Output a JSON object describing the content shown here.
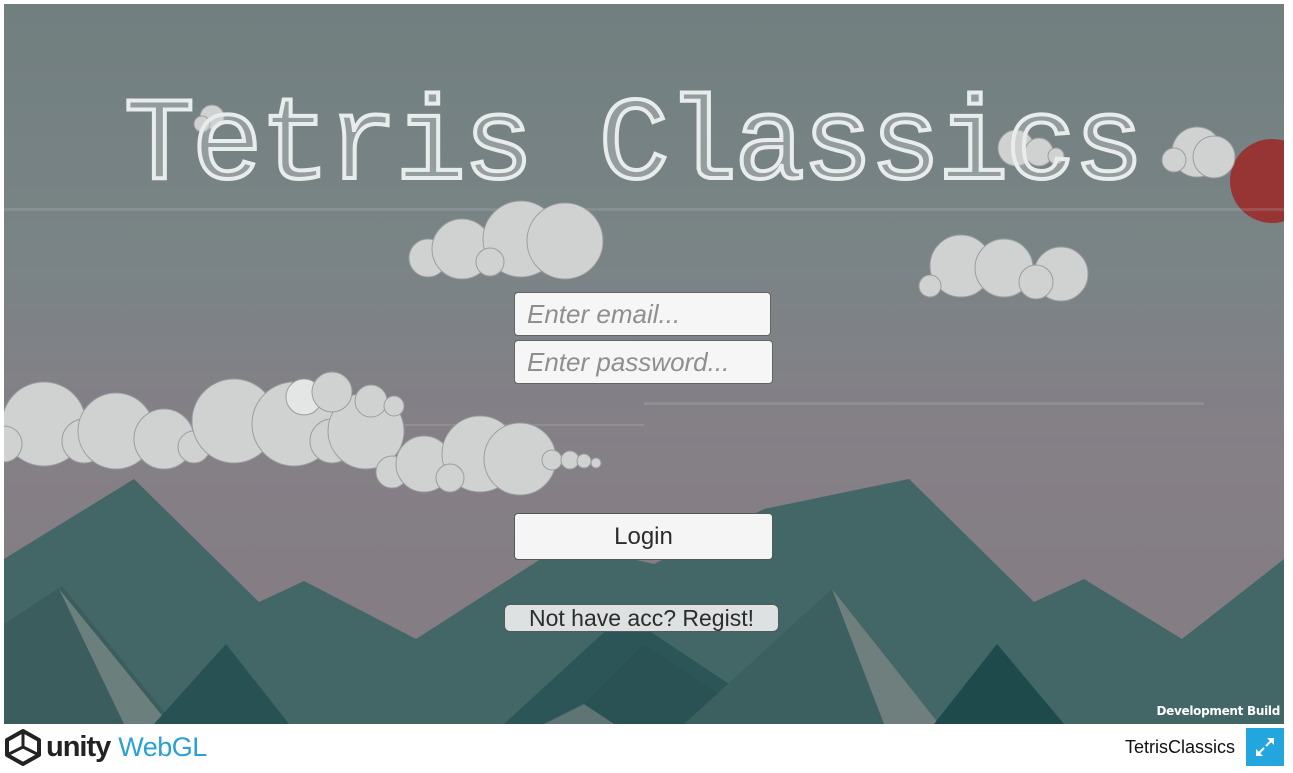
{
  "game": {
    "title": "Tetris Classics",
    "email_placeholder": "Enter email...",
    "password_placeholder": "Enter password...",
    "login_label": "Login",
    "register_label": "Not have acc? Regist!",
    "build_label": "Development Build"
  },
  "footer": {
    "unity_label": "unity",
    "webgl_label": "WebGL",
    "game_name": "TetrisClassics",
    "fullscreen_icon": "fullscreen-icon"
  },
  "colors": {
    "sky_top": "#717f7f",
    "sky_bottom": "#837c82",
    "mountain": "#436667",
    "sun": "#973535",
    "webgl_blue": "#2aa0d6",
    "fullscreen_button": "#23a6de"
  }
}
